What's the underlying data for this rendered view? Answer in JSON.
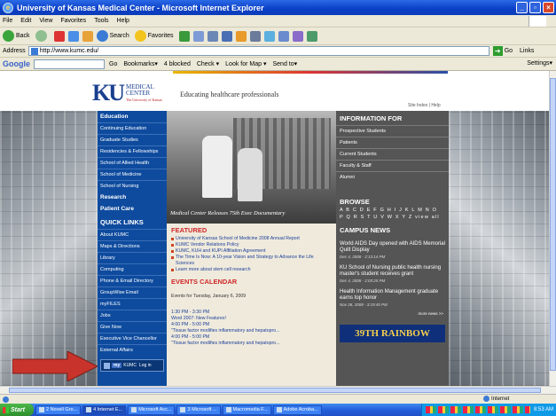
{
  "window": {
    "title": "University of Kansas Medical Center - Microsoft Internet Explorer"
  },
  "menu": [
    "File",
    "Edit",
    "View",
    "Favorites",
    "Tools",
    "Help"
  ],
  "toolbar": {
    "back": "Back",
    "search": "Search",
    "favorites": "Favorites"
  },
  "address": {
    "label": "Address",
    "url": "http://www.kumc.edu/",
    "go": "Go",
    "links": "Links"
  },
  "google": {
    "logo": "Google",
    "items": [
      "Go",
      "Bookmarks▾",
      "4 blocked",
      "Check ▾",
      "Look for Map ▾",
      "Send to▾"
    ],
    "settings": "Settings▾"
  },
  "page": {
    "logo_letters": "KU",
    "logo_medical": "MEDICAL",
    "logo_center": "CENTER",
    "logo_sub": "The University of Kansas",
    "tagline": "Educating healthcare professionals",
    "site_index": "Site Index | Help",
    "nav": {
      "education_heading": "Education",
      "education_items": [
        "Continuing Education",
        "Graduate Studies",
        "Residencies & Fellowships",
        "School of Allied Health",
        "School of Medicine",
        "School of Nursing"
      ],
      "research": "Research",
      "patient_care": "Patient Care",
      "quick_links_heading": "QUICK LINKS",
      "quick_links": [
        "About KUMC",
        "Maps & Directions",
        "Library",
        "Computing",
        "Phone & Email Directory",
        "GroupWise Email",
        "myFILES",
        "Jobs",
        "Give Now",
        "Executive Vice Chancellor",
        "External Affairs"
      ],
      "myku": {
        "badge": "my",
        "label": "KUMC",
        "action": "Log in"
      }
    },
    "hero_caption": "Medical Center Releases 75th Exec Documentary",
    "featured": {
      "heading": "FEATURED",
      "items": [
        "University of Kansas School of Medicine 2008 Annual Report",
        "KUMC Vendor Relations Policy",
        "KUMC, KUH and KUPI Affiliation Agreement",
        "The Time Is Now: A 10-year Vision and Strategy to Advance the Life Sciences",
        "Learn more about stem cell research"
      ]
    },
    "events": {
      "heading": "EVENTS CALENDAR",
      "date_line": "Events for Tuesday, January 6, 2009",
      "lines": [
        "1:30 PM - 3:30 PM",
        "Word 2007: New Features!",
        "4:00 PM - 5:00 PM",
        "\"Tissue factor modifies inflammatory and hepatopro...",
        "4:00 PM - 5:00 PM",
        "\"Tissue factor modifies inflammatory and hepatopro..."
      ]
    },
    "info_for": {
      "heading": "INFORMATION FOR",
      "items": [
        "Prospective Students",
        "Patients",
        "Current Students",
        "Faculty & Staff",
        "Alumni"
      ]
    },
    "browse": {
      "heading": "BROWSE",
      "row1": "A B C D E F G H I J K L M N O",
      "row2": "P Q R S T U V W X Y Z  view all"
    },
    "campus_news": {
      "heading": "CAMPUS NEWS",
      "items": [
        {
          "title": "World AIDS Day opened with AIDS Memorial Quilt Display",
          "date": "Dec 4, 2008 - 2:13:14 PM"
        },
        {
          "title": "KU School of Nursing public health nursing master's student receives grant",
          "date": "Dec 4, 2008 - 2:03:25 PM"
        },
        {
          "title": "Health Information Management graduate earns top honor",
          "date": "Nov 26, 2008 - 3:19:45 PM"
        }
      ],
      "more": "more news >>"
    },
    "rainbow_banner": "39TH RAINBOW"
  },
  "status": {
    "zone": "Internet"
  },
  "taskbar": {
    "start": "Start",
    "tasks": [
      "2 Novell Gro...",
      "4 Internet E...",
      "Microsoft Acc...",
      "3 Microsoft ...",
      "Macromedia F...",
      "Adobe Acroba..."
    ],
    "clock": "8:53 AM"
  },
  "colors": {
    "nav_blue": "#0e4b9e",
    "right_gray": "#555555",
    "featured_red": "#d02828",
    "arrow_red": "#c8342b"
  }
}
